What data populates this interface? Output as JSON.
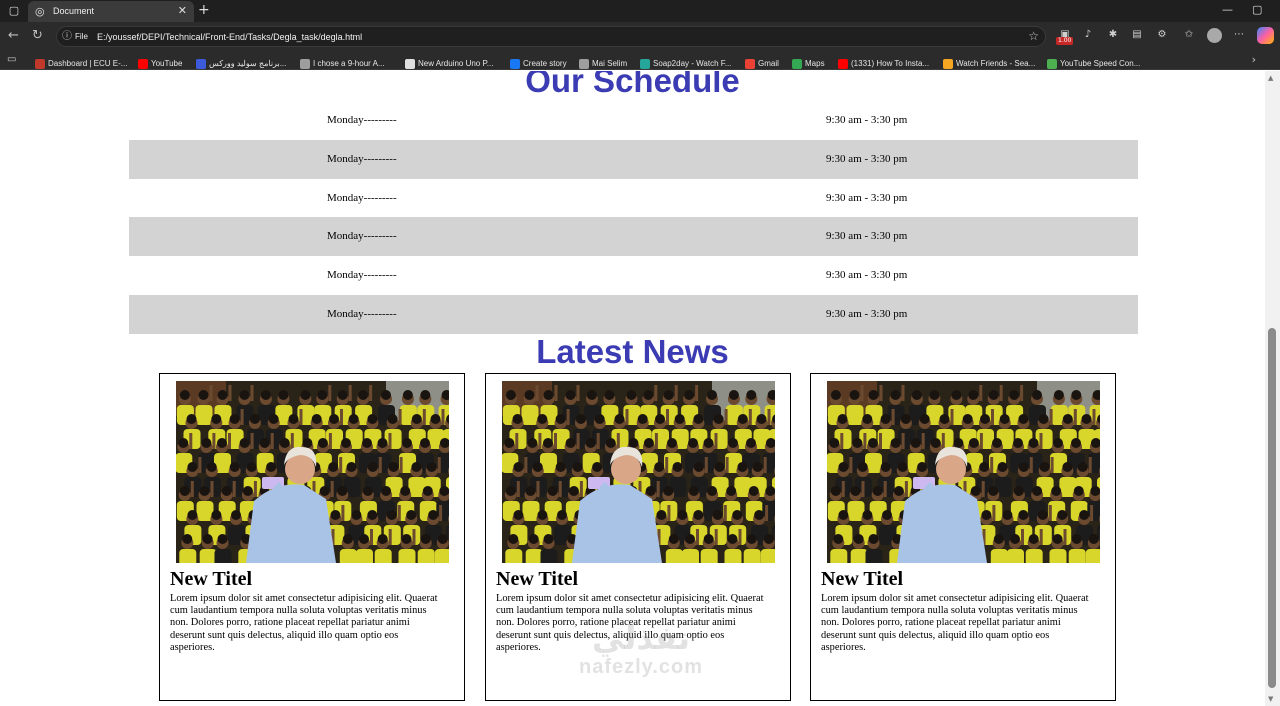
{
  "browser": {
    "tab_title": "Document",
    "url_scheme": "File",
    "url": "E:/youssef/DEPI/Technical/Front-End/Tasks/Degla_task/degla.html",
    "extension_badge": "1.00",
    "bookmarks": [
      {
        "label": "Dashboard | ECU E-...",
        "icon": "ecu-icon",
        "color": "#c0392b"
      },
      {
        "label": "YouTube",
        "icon": "youtube-icon",
        "color": "#ff0000"
      },
      {
        "label": "برنامج سوليد ووركس...",
        "icon": "solidworks-icon",
        "color": "#3b5bdb"
      },
      {
        "label": "I chose a 9-hour A...",
        "icon": "globe-icon",
        "color": "#9e9e9e"
      },
      {
        "label": "New Arduino Uno P...",
        "icon": "w-icon",
        "color": "#e0e0e0"
      },
      {
        "label": "Create story",
        "icon": "facebook-icon",
        "color": "#1877f2"
      },
      {
        "label": "Mai Selim",
        "icon": "globe-icon",
        "color": "#9e9e9e"
      },
      {
        "label": "Soap2day - Watch F...",
        "icon": "soap2day-icon",
        "color": "#26a69a"
      },
      {
        "label": "Gmail",
        "icon": "gmail-icon",
        "color": "#ea4335"
      },
      {
        "label": "Maps",
        "icon": "maps-icon",
        "color": "#34a853"
      },
      {
        "label": "(1331) How To Insta...",
        "icon": "youtube-icon",
        "color": "#ff0000"
      },
      {
        "label": "Watch Friends - Sea...",
        "icon": "play-icon",
        "color": "#f5a623"
      },
      {
        "label": "YouTube Speed Con...",
        "icon": "microsoft-icon",
        "color": "#4caf50"
      }
    ]
  },
  "page": {
    "schedule_title": "Our Schedule",
    "schedule": [
      {
        "day": "Monday---------",
        "time": "9:30 am - 3:30 pm"
      },
      {
        "day": "Monday---------",
        "time": "9:30 am - 3:30 pm"
      },
      {
        "day": "Monday---------",
        "time": "9:30 am - 3:30 pm"
      },
      {
        "day": "Monday---------",
        "time": "9:30 am - 3:30 pm"
      },
      {
        "day": "Monday---------",
        "time": "9:30 am - 3:30 pm"
      },
      {
        "day": "Monday---------",
        "time": "9:30 am - 3:30 pm"
      }
    ],
    "news_title": "Latest News",
    "news": [
      {
        "title": "New Titel",
        "body": "Lorem ipsum dolor sit amet consectetur adipisicing elit. Quaerat cum laudantium tempora nulla soluta voluptas veritatis minus non. Dolores porro, ratione placeat repellat pariatur animi deserunt sunt quis delectus, aliquid illo quam optio eos asperiores."
      },
      {
        "title": "New Titel",
        "body": "Lorem ipsum dolor sit amet consectetur adipisicing elit. Quaerat cum laudantium tempora nulla soluta voluptas veritatis minus non. Dolores porro, ratione placeat repellat pariatur animi deserunt sunt quis delectus, aliquid illo quam optio eos asperiores."
      },
      {
        "title": "New Titel",
        "body": "Lorem ipsum dolor sit amet consectetur adipisicing elit. Quaerat cum laudantium tempora nulla soluta voluptas veritatis minus non. Dolores porro, ratione placeat repellat pariatur animi deserunt sunt quis delectus, aliquid illo quam optio eos asperiores."
      }
    ],
    "watermark": {
      "arabic": "نفذلي",
      "latin": "nafezly.com"
    }
  },
  "colors": {
    "heading": "#3b3bb3",
    "row_shade": "#d3d3d3",
    "photo_shirt_yellow": "#d8d62a",
    "photo_shirt_dark": "#1c1c1c"
  }
}
